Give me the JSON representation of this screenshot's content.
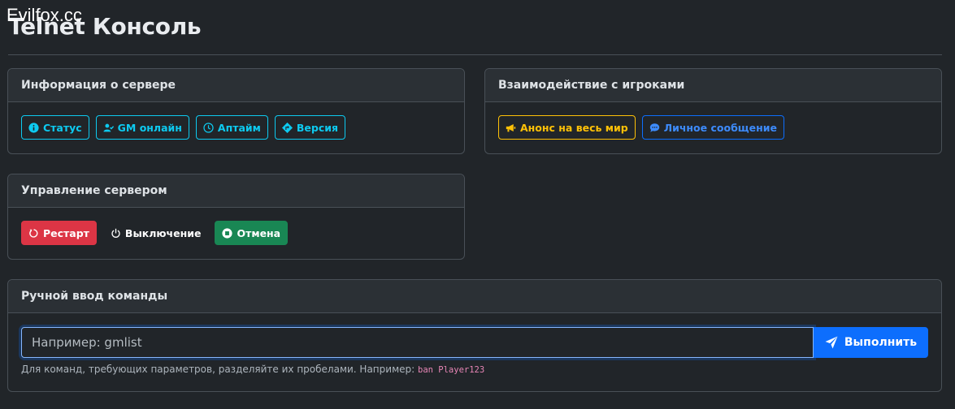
{
  "watermark": "Evilfox.cc",
  "page_title": "Telnet Консоль",
  "server_info": {
    "title": "Информация о сервере",
    "buttons": [
      {
        "label": "Статус",
        "icon": "info-circle-icon"
      },
      {
        "label": "GM онлайн",
        "icon": "user-check-icon"
      },
      {
        "label": "Аптайм",
        "icon": "clock-icon"
      },
      {
        "label": "Версия",
        "icon": "code-branch-icon"
      }
    ]
  },
  "players": {
    "title": "Взаимодействие с игроками",
    "buttons": [
      {
        "label": "Анонс на весь мир",
        "icon": "megaphone-icon"
      },
      {
        "label": "Личное сообщение",
        "icon": "chat-bubble-icon"
      }
    ]
  },
  "server_control": {
    "title": "Управление сервером",
    "buttons": [
      {
        "label": "Рестарт",
        "icon": "restart-icon"
      },
      {
        "label": "Выключение",
        "icon": "power-icon"
      },
      {
        "label": "Отмена",
        "icon": "stop-circle-icon"
      }
    ]
  },
  "manual": {
    "title": "Ручной ввод команды",
    "placeholder": "Например: gmlist",
    "execute_label": "Выполнить",
    "execute_icon": "paper-plane-icon",
    "help_text": "Для команд, требующих параметров, разделяйте их пробелами. Например:",
    "help_example": "ban Player123"
  },
  "colors": {
    "background": "#212529",
    "info": "#0dcaf0",
    "warning": "#ffc107",
    "primary": "#0d6efd",
    "danger": "#dc3545",
    "success": "#198754"
  }
}
